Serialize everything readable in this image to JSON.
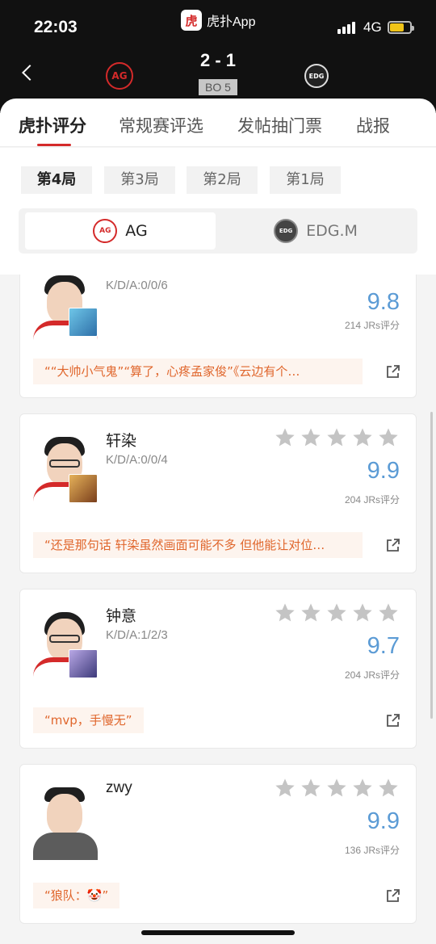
{
  "status_bar": {
    "time": "22:03",
    "network": "4G",
    "battery_level": 0.7
  },
  "app": {
    "logo_char": "虎",
    "name": "虎扑App"
  },
  "match": {
    "score": "2 - 1",
    "format": "BO 5",
    "left_team_logo_text": "AG",
    "right_team_logo_text": "EDG"
  },
  "tabs": [
    {
      "label": "虎扑评分",
      "active": true
    },
    {
      "label": "常规赛评选",
      "active": false
    },
    {
      "label": "发帖抽门票",
      "active": false
    },
    {
      "label": "战报",
      "active": false
    }
  ],
  "rounds": [
    {
      "label": "第4局",
      "active": true
    },
    {
      "label": "第3局",
      "active": false
    },
    {
      "label": "第2局",
      "active": false
    },
    {
      "label": "第1局",
      "active": false
    }
  ],
  "teams": [
    {
      "name": "AG",
      "logo_text": "AG",
      "active": true
    },
    {
      "name": "EDG.M",
      "logo_text": "EDG",
      "active": false
    }
  ],
  "colors": {
    "accent": "#d42a2a",
    "score_blue": "#5b9bd5",
    "comment_text": "#e0662c",
    "star_gray": "#c4c4c4"
  },
  "players": [
    {
      "name": "",
      "kda": "K/D/A:0/0/6",
      "score": "9.8",
      "ratings": "214 JRs评分",
      "comment": "““大帅小气鬼”“算了，心疼孟家俊”《云边有个…",
      "stars_filled": 0
    },
    {
      "name": "轩染",
      "kda": "K/D/A:0/0/4",
      "score": "9.9",
      "ratings": "204 JRs评分",
      "comment": "“还是那句话 轩染虽然画面可能不多 但他能让对位…",
      "stars_filled": 0
    },
    {
      "name": "钟意",
      "kda": "K/D/A:1/2/3",
      "score": "9.7",
      "ratings": "204 JRs评分",
      "comment": "“mvp，手慢无”",
      "stars_filled": 0
    },
    {
      "name": "zwy",
      "kda": "",
      "score": "9.9",
      "ratings": "136 JRs评分",
      "comment": "“狼队：🤡”",
      "stars_filled": 0
    }
  ]
}
